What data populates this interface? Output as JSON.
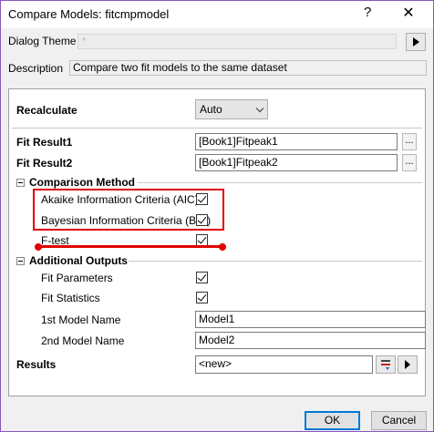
{
  "window": {
    "title": "Compare Models: fitcmpmodel",
    "help_glyph": "?",
    "close_glyph": "✕"
  },
  "theme": {
    "label": "Dialog Theme",
    "value": "*"
  },
  "description": {
    "label": "Description",
    "value": "Compare two fit models to the same dataset"
  },
  "recalculate": {
    "label": "Recalculate",
    "value": "Auto"
  },
  "fit_result1": {
    "label": "Fit Result1",
    "value": "[Book1]Fitpeak1",
    "browse": "..."
  },
  "fit_result2": {
    "label": "Fit Result2",
    "value": "[Book1]Fitpeak2",
    "browse": "..."
  },
  "comparison": {
    "label": "Comparison Method",
    "aic": {
      "label": "Akaike Information Criteria (AIC)",
      "checked": true
    },
    "bic": {
      "label": "Bayesian Information Criteria (BIC)",
      "checked": true
    },
    "ftest": {
      "label": "F-test",
      "checked": true
    }
  },
  "outputs": {
    "label": "Additional Outputs",
    "fit_params": {
      "label": "Fit Parameters",
      "checked": true
    },
    "fit_stats": {
      "label": "Fit Statistics",
      "checked": true
    },
    "model1": {
      "label": "1st Model Name",
      "value": "Model1"
    },
    "model2": {
      "label": "2nd Model Name",
      "value": "Model2"
    }
  },
  "results": {
    "label": "Results",
    "value": "<new>"
  },
  "buttons": {
    "ok": "OK",
    "cancel": "Cancel"
  },
  "colors": {
    "highlight": "#e00000",
    "window_border": "#8b55c2"
  }
}
